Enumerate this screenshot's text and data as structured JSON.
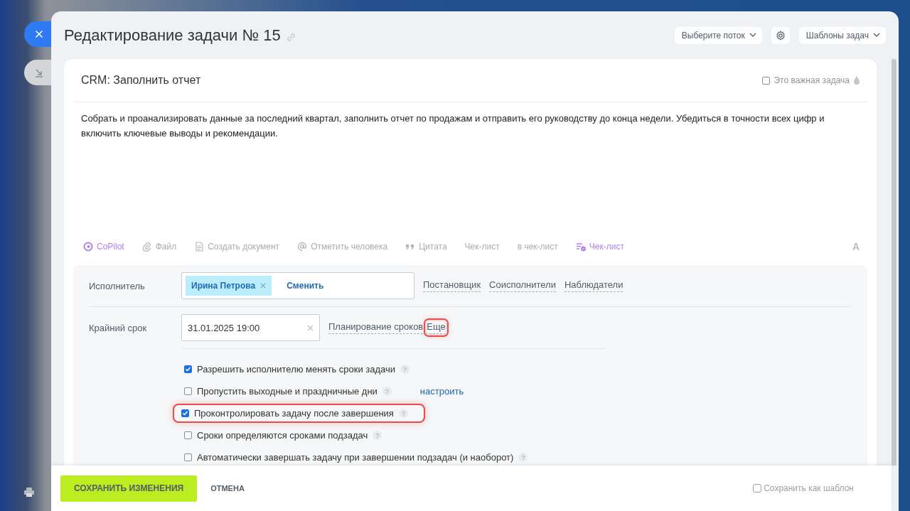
{
  "title": "Редактирование задачи № 15",
  "header_controls": [
    {
      "kind": "dropdown",
      "label": "Выберите поток"
    },
    {
      "kind": "gear"
    },
    {
      "kind": "dropdown",
      "label": "Шаблоны задач"
    }
  ],
  "task": {
    "title": "CRM: Заполнить отчет",
    "important": {
      "label": "Это важная задача",
      "checked": false
    },
    "description": "Собрать и проанализировать данные за последний квартал, заполнить отчет по продажам и отправить его руководству до конца недели. Убедиться в точности всех цифр и включить ключевые выводы и рекомендации."
  },
  "toolbar": [
    {
      "kind": "copilot",
      "label": "CoPilot"
    },
    {
      "kind": "clip",
      "label": "Файл"
    },
    {
      "kind": "document",
      "label": "Создать документ"
    },
    {
      "kind": "at",
      "label": "Отметить человека"
    },
    {
      "kind": "quote",
      "label": "Цитата"
    },
    {
      "kind": "plain",
      "label": "Чек-лист"
    },
    {
      "kind": "plain",
      "label": "в чек-лист"
    },
    {
      "kind": "checklist",
      "label": "Чек-лист"
    },
    {
      "kind": "font",
      "label": "A"
    }
  ],
  "assignee": {
    "label": "Исполнитель",
    "chips": [
      {
        "name": "Ирина Петрова"
      }
    ],
    "change_link": "Сменить",
    "role_links": [
      "Постановщик",
      "Соисполнители",
      "Наблюдатели"
    ]
  },
  "deadline": {
    "label": "Крайний срок",
    "value": "31.01.2025 19:00",
    "links": [
      {
        "label": "Планирование сроков",
        "highlighted": false
      },
      {
        "label": "Еще",
        "highlighted": true
      }
    ]
  },
  "options": [
    {
      "label": "Разрешить исполнителю менять сроки задачи",
      "checked": true,
      "highlighted": false,
      "help": "?"
    },
    {
      "label": "Пропустить выходные и праздничные дни",
      "checked": false,
      "highlighted": false,
      "help": "?",
      "link": "настроить"
    },
    {
      "label": "Проконтролировать задачу после завершения",
      "checked": true,
      "highlighted": true,
      "help": "?"
    },
    {
      "label": "Сроки определяются сроками подзадач",
      "checked": false,
      "highlighted": false,
      "help": "?"
    },
    {
      "label": "Автоматически завершать задачу при завершении подзадач (и наоборот)",
      "checked": false,
      "highlighted": false,
      "help": "?"
    }
  ],
  "footer": {
    "save": "СОХРАНИТЬ ИЗМЕНЕНИЯ",
    "cancel": "ОТМЕНА",
    "template": {
      "label": "Сохранить как шаблон",
      "checked": false
    }
  }
}
